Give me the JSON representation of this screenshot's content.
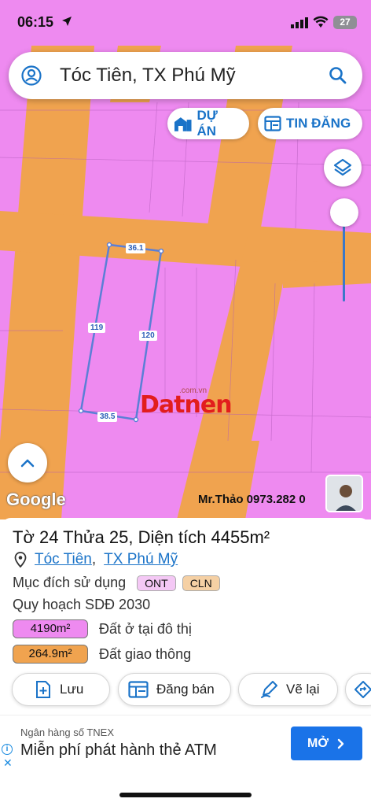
{
  "status": {
    "time": "06:15",
    "battery": "27"
  },
  "search": {
    "text": "Tóc Tiên, TX Phú Mỹ"
  },
  "pills": {
    "du_an": "DỰ ÁN",
    "tin_dang": "TIN ĐĂNG"
  },
  "map": {
    "edge_labels": [
      "36.1",
      "119",
      "120",
      "38.5"
    ],
    "watermark": {
      "brand": "Datnen",
      "sub": ".com.vn"
    },
    "google": "Google",
    "contact": "Mr.Thảo 0973.282 0",
    "colors": {
      "residential": "#ee8af0",
      "road": "#f0a34f",
      "parcel_outline": "#5b7fd6"
    }
  },
  "parcel": {
    "title": "Tờ 24 Thửa 25, Diện tích 4455m²",
    "ward": "Tóc Tiên",
    "town": "TX Phú Mỹ",
    "purpose_label": "Mục đích sử dụng",
    "tags": [
      "ONT",
      "CLN"
    ],
    "plan_label": "Quy hoạch SDĐ 2030",
    "uses": [
      {
        "area": "4190m²",
        "label": "Đất ở tại đô thị"
      },
      {
        "area": "264.9m²",
        "label": "Đất giao thông"
      }
    ]
  },
  "actions": {
    "save": "Lưu",
    "sell": "Đăng bán",
    "redraw": "Vẽ lại"
  },
  "ad": {
    "bank": "Ngân hàng số TNEX",
    "headline": "Miễn phí phát hành thẻ ATM",
    "cta": "MỞ"
  }
}
